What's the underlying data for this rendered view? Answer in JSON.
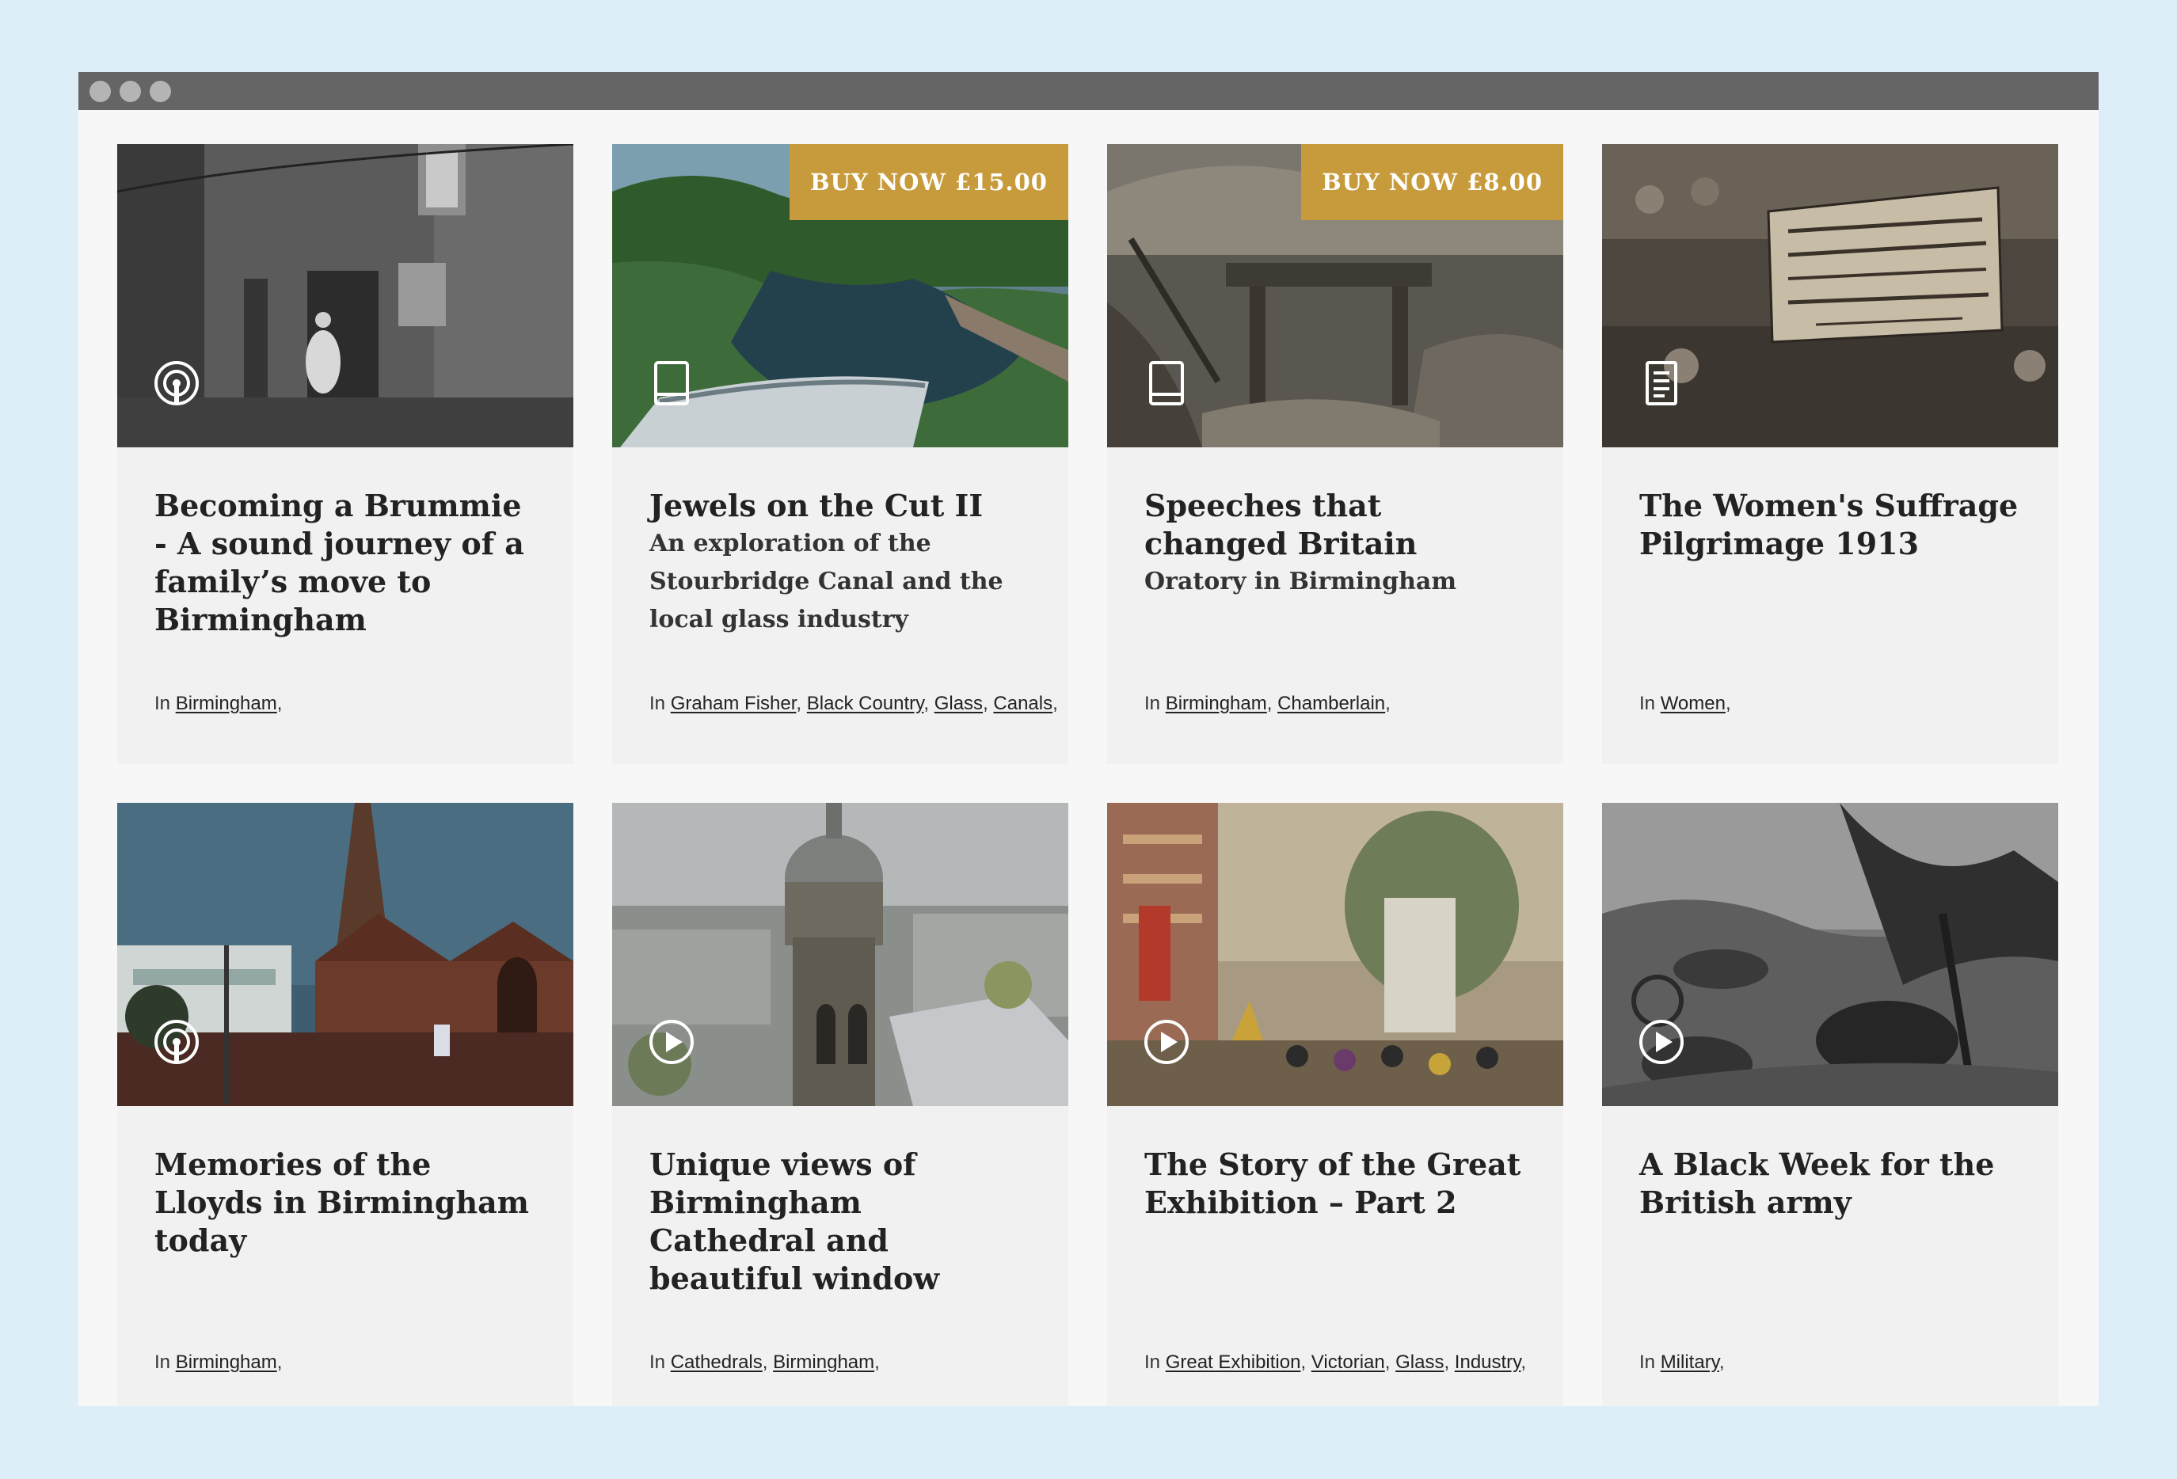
{
  "window": {
    "controls": [
      "close",
      "minimize",
      "maximize"
    ]
  },
  "cards": [
    {
      "title": "Becoming a Brummie - A sound journey of a family’s move to Birmingham",
      "subtitle": "",
      "media": "podcast-icon",
      "buy_label": "",
      "tags_prefix": "In",
      "tags": [
        "Birmingham"
      ]
    },
    {
      "title": "Jewels on the Cut II",
      "subtitle": "An exploration of the Stourbridge Canal and the local glass industry",
      "media": "book-icon",
      "buy_label": "BUY NOW £15.00",
      "tags_prefix": "In",
      "tags": [
        "Graham Fisher",
        "Black Country",
        "Glass",
        "Canals"
      ]
    },
    {
      "title": "Speeches that changed Britain",
      "subtitle": "Oratory in Birmingham",
      "media": "book-icon",
      "buy_label": "BUY NOW £8.00",
      "tags_prefix": "In",
      "tags": [
        "Birmingham",
        "Chamberlain"
      ]
    },
    {
      "title": "The Women's Suffrage Pilgrimage 1913",
      "subtitle": "",
      "media": "document-icon",
      "buy_label": "",
      "tags_prefix": "In",
      "tags": [
        "Women"
      ]
    },
    {
      "title": "Memories of the Lloyds in Birmingham today",
      "subtitle": "",
      "media": "podcast-icon",
      "buy_label": "",
      "tags_prefix": "In",
      "tags": [
        "Birmingham"
      ]
    },
    {
      "title": "Unique views of Birmingham Cathedral and beautiful window",
      "subtitle": "",
      "media": "play-icon",
      "buy_label": "",
      "tags_prefix": "In",
      "tags": [
        "Cathedrals",
        "Birmingham"
      ]
    },
    {
      "title": "The Story of the Great Exhibition – Part 2",
      "subtitle": "",
      "media": "play-icon",
      "buy_label": "",
      "tags_prefix": "In",
      "tags": [
        "Great Exhibition",
        "Victorian",
        "Glass",
        "Industry"
      ]
    },
    {
      "title": "A Black Week for the British army",
      "subtitle": "",
      "media": "play-icon",
      "buy_label": "",
      "tags_prefix": "In",
      "tags": [
        "Military"
      ]
    }
  ],
  "colors": {
    "page_background": "#deeef8",
    "window_background": "#f7f7f7",
    "titlebar": "#656565",
    "card_background": "#f1f1f1",
    "buy_badge": "#c79b3b",
    "title_text": "#222222"
  }
}
